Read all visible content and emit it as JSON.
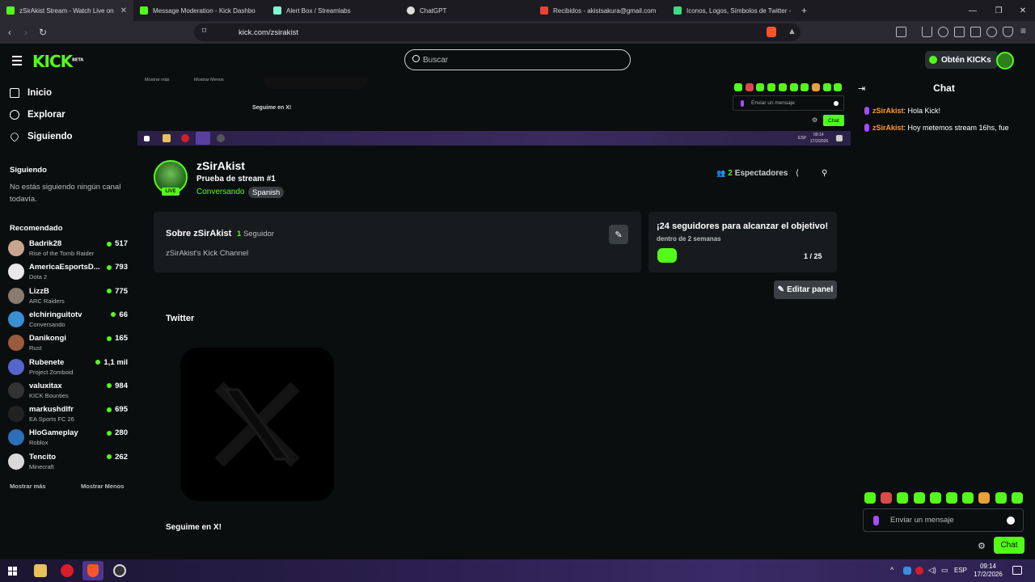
{
  "browser": {
    "tabs": [
      {
        "title": "zSirAkist Stream - Watch Live on",
        "color": "#53fc18",
        "active": true
      },
      {
        "title": "Message Moderation - Kick Dashbo",
        "color": "#53fc18"
      },
      {
        "title": "Alert Box / Streamlabs",
        "color": "#80f5d2"
      },
      {
        "title": "ChatGPT",
        "color": "#dddddd"
      },
      {
        "title": "Recibidos - akistsakura@gmail.com",
        "color": "#ea4335"
      },
      {
        "title": "Iconos, Logos, Símbolos de Twitter -",
        "color": "#3ddc84"
      }
    ],
    "new_tab": "+",
    "url": "kick.com/zsirakist"
  },
  "header": {
    "logo": "KICK",
    "logo_sup": "BETA",
    "search_placeholder": "Buscar",
    "kicks_button": "Obtén KICKs"
  },
  "sidebar": {
    "nav": [
      {
        "label": "Inicio",
        "icon": "home-icon"
      },
      {
        "label": "Explorar",
        "icon": "compass-icon"
      },
      {
        "label": "Siguiendo",
        "icon": "heart-icon"
      }
    ],
    "following_title": "Siguiendo",
    "following_empty": "No estás siguiendo ningún canal todavía.",
    "recommended_title": "Recomendado",
    "recommended": [
      {
        "name": "Badrik28",
        "category": "Rise of the Tomb Raider",
        "viewers": "517",
        "color": "#c7a58f"
      },
      {
        "name": "AmericaEsportsD...",
        "category": "Dota 2",
        "viewers": "793",
        "color": "#e9e9e9"
      },
      {
        "name": "LizzB",
        "category": "ARC Raiders",
        "viewers": "775",
        "color": "#8a7a70"
      },
      {
        "name": "elchiringuitotv",
        "category": "Conversando",
        "viewers": "66",
        "color": "#3b8fd1"
      },
      {
        "name": "Danikongi",
        "category": "Rust",
        "viewers": "165",
        "color": "#9c5a3c"
      },
      {
        "name": "Rubenete",
        "category": "Project Zomboid",
        "viewers": "1,1 mil",
        "color": "#5566cc"
      },
      {
        "name": "valuxitax",
        "category": "KICK Bounties",
        "viewers": "984",
        "color": "#333333"
      },
      {
        "name": "markushdlfr",
        "category": "EA Sports FC 26",
        "viewers": "695",
        "color": "#222222"
      },
      {
        "name": "HloGameplay",
        "category": "Roblox",
        "viewers": "280",
        "color": "#2c6fb8"
      },
      {
        "name": "Tencito",
        "category": "Minecraft",
        "viewers": "262",
        "color": "#d9d9d9"
      }
    ],
    "show_more": "Mostrar más",
    "show_less": "Mostrar Menos"
  },
  "preview": {
    "show_more": "Mostrar más",
    "show_less": "Mostrar Menos",
    "caption": "Seguime en X!",
    "chat_placeholder": "Enviar un mensaje",
    "chat_button": "Chat",
    "taskbar_time": "09:14",
    "taskbar_date": "17/2/2026",
    "taskbar_lang": "ESP"
  },
  "channel": {
    "name": "zSirAkist",
    "live_badge": "LIVE",
    "stream_title": "Prueba de stream #1",
    "category": "Conversando",
    "language": "Spanish",
    "viewers_count": "2",
    "viewers_label": "Espectadores"
  },
  "about": {
    "title": "Sobre zSirAkist",
    "followers_count": "1",
    "followers_label": "Seguidor",
    "description": "zSirAkist's Kick Channel"
  },
  "goal": {
    "title": "¡24 seguidores para alcanzar el objetivo!",
    "subtitle": "dentro de 2 semanas",
    "progress": "1 / 25"
  },
  "edit_panel_label": "Editar panel",
  "twitter_panel": {
    "title": "Twitter",
    "caption": "Seguime en X!"
  },
  "chat": {
    "title": "Chat",
    "messages": [
      {
        "user": "zSirAkist",
        "text": "Hola Kick!"
      },
      {
        "user": "zSirAkist",
        "text": "Hoy metemos stream 16hs, fue"
      }
    ],
    "input_placeholder": "Enviar un mensaje",
    "send_button": "Chat"
  },
  "taskbar": {
    "lang": "ESP",
    "time": "09:14",
    "date": "17/2/2026"
  },
  "colors": {
    "kick_green": "#53fc18",
    "background": "#0b0e0f",
    "card": "#181b1d",
    "username": "#ff9a2e"
  }
}
